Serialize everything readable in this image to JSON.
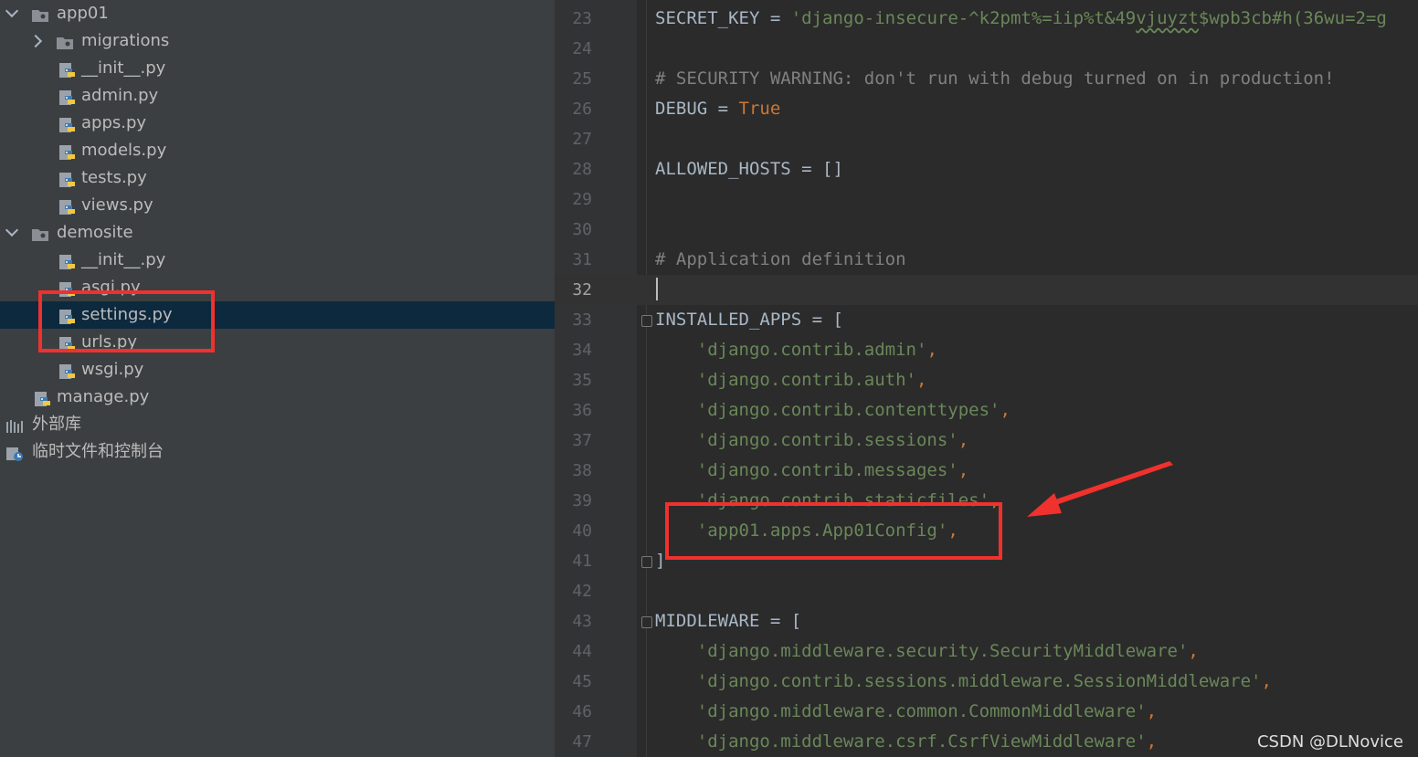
{
  "project_tree": {
    "items": [
      {
        "label": "app01",
        "expanded": true,
        "icon": "folder-icon"
      },
      {
        "label": "migrations",
        "expanded": false,
        "icon": "folder-icon"
      },
      {
        "label": "__init__.py",
        "icon": "python-file-icon"
      },
      {
        "label": "admin.py",
        "icon": "python-file-icon"
      },
      {
        "label": "apps.py",
        "icon": "python-file-icon"
      },
      {
        "label": "models.py",
        "icon": "python-file-icon"
      },
      {
        "label": "tests.py",
        "icon": "python-file-icon"
      },
      {
        "label": "views.py",
        "icon": "python-file-icon"
      },
      {
        "label": "demosite",
        "expanded": true,
        "icon": "folder-icon"
      },
      {
        "label": "__init__.py",
        "icon": "python-file-icon"
      },
      {
        "label": "asgi.py",
        "icon": "python-file-icon"
      },
      {
        "label": "settings.py",
        "icon": "python-file-icon",
        "selected": true
      },
      {
        "label": "urls.py",
        "icon": "python-file-icon"
      },
      {
        "label": "wsgi.py",
        "icon": "python-file-icon"
      },
      {
        "label": "manage.py",
        "icon": "python-file-icon"
      },
      {
        "label": "外部库",
        "icon": "library-icon"
      },
      {
        "label": "临时文件和控制台",
        "icon": "scratches-icon"
      }
    ]
  },
  "editor": {
    "lines": [
      {
        "no": "23",
        "tokens": [
          {
            "t": "SECRET_KEY ",
            "c": "id"
          },
          {
            "t": "= ",
            "c": "op"
          },
          {
            "t": "'django-insecure-^k2pmt%=iip%t&49",
            "c": "str"
          },
          {
            "t": "vjuyzt",
            "c": "str-sq"
          },
          {
            "t": "$wpb3cb#h(36wu=2=g",
            "c": "str"
          }
        ]
      },
      {
        "no": "24",
        "tokens": []
      },
      {
        "no": "25",
        "tokens": [
          {
            "t": "# SECURITY WARNING: don't run with debug turned on in production!",
            "c": "cm"
          }
        ]
      },
      {
        "no": "26",
        "tokens": [
          {
            "t": "DEBUG ",
            "c": "id"
          },
          {
            "t": "= ",
            "c": "op"
          },
          {
            "t": "True",
            "c": "kw"
          }
        ]
      },
      {
        "no": "27",
        "tokens": []
      },
      {
        "no": "28",
        "tokens": [
          {
            "t": "ALLOWED_HOSTS ",
            "c": "id"
          },
          {
            "t": "= []",
            "c": "op"
          }
        ]
      },
      {
        "no": "29",
        "tokens": []
      },
      {
        "no": "30",
        "tokens": []
      },
      {
        "no": "31",
        "tokens": [
          {
            "t": "# Application definition",
            "c": "cm"
          }
        ]
      },
      {
        "no": "32",
        "tokens": [],
        "current": true
      },
      {
        "no": "33",
        "fold": true,
        "tokens": [
          {
            "t": "INSTALLED_APPS ",
            "c": "id"
          },
          {
            "t": "= [",
            "c": "op"
          }
        ]
      },
      {
        "no": "34",
        "tokens": [
          {
            "t": "    ",
            "c": "id"
          },
          {
            "t": "'django.contrib.admin'",
            "c": "str"
          },
          {
            "t": ",",
            "c": "kw"
          }
        ]
      },
      {
        "no": "35",
        "tokens": [
          {
            "t": "    ",
            "c": "id"
          },
          {
            "t": "'django.contrib.auth'",
            "c": "str"
          },
          {
            "t": ",",
            "c": "kw"
          }
        ]
      },
      {
        "no": "36",
        "tokens": [
          {
            "t": "    ",
            "c": "id"
          },
          {
            "t": "'django.contrib.contenttypes'",
            "c": "str"
          },
          {
            "t": ",",
            "c": "kw"
          }
        ]
      },
      {
        "no": "37",
        "tokens": [
          {
            "t": "    ",
            "c": "id"
          },
          {
            "t": "'django.contrib.sessions'",
            "c": "str"
          },
          {
            "t": ",",
            "c": "kw"
          }
        ]
      },
      {
        "no": "38",
        "tokens": [
          {
            "t": "    ",
            "c": "id"
          },
          {
            "t": "'django.contrib.messages'",
            "c": "str"
          },
          {
            "t": ",",
            "c": "kw"
          }
        ]
      },
      {
        "no": "39",
        "tokens": [
          {
            "t": "    ",
            "c": "id"
          },
          {
            "t": "'django.contrib.staticfiles'",
            "c": "str"
          },
          {
            "t": ",",
            "c": "kw"
          }
        ]
      },
      {
        "no": "40",
        "tokens": [
          {
            "t": "    ",
            "c": "id"
          },
          {
            "t": "'app01.apps.App01Config'",
            "c": "str"
          },
          {
            "t": ",",
            "c": "kw"
          }
        ]
      },
      {
        "no": "41",
        "fold": true,
        "tokens": [
          {
            "t": "]",
            "c": "op"
          }
        ]
      },
      {
        "no": "42",
        "tokens": []
      },
      {
        "no": "43",
        "fold": true,
        "tokens": [
          {
            "t": "MIDDLEWARE ",
            "c": "id"
          },
          {
            "t": "= [",
            "c": "op"
          }
        ]
      },
      {
        "no": "44",
        "tokens": [
          {
            "t": "    ",
            "c": "id"
          },
          {
            "t": "'django.middleware.security.SecurityMiddleware'",
            "c": "str"
          },
          {
            "t": ",",
            "c": "kw"
          }
        ]
      },
      {
        "no": "45",
        "tokens": [
          {
            "t": "    ",
            "c": "id"
          },
          {
            "t": "'django.contrib.sessions.middleware.SessionMiddleware'",
            "c": "str"
          },
          {
            "t": ",",
            "c": "kw"
          }
        ]
      },
      {
        "no": "46",
        "tokens": [
          {
            "t": "    ",
            "c": "id"
          },
          {
            "t": "'django.middleware.common.CommonMiddleware'",
            "c": "str"
          },
          {
            "t": ",",
            "c": "kw"
          }
        ]
      },
      {
        "no": "47",
        "tokens": [
          {
            "t": "    ",
            "c": "id"
          },
          {
            "t": "'django.middleware.csrf.CsrfViewMiddleware'",
            "c": "str"
          },
          {
            "t": ",",
            "c": "kw"
          }
        ]
      }
    ]
  },
  "colors": {
    "annotation_red": "#f0312d",
    "string_green": "#6a8759",
    "keyword_orange": "#cc7832",
    "comment_gray": "#808080",
    "selection_blue": "#0d293e"
  },
  "watermark": "CSDN @DLNovice"
}
